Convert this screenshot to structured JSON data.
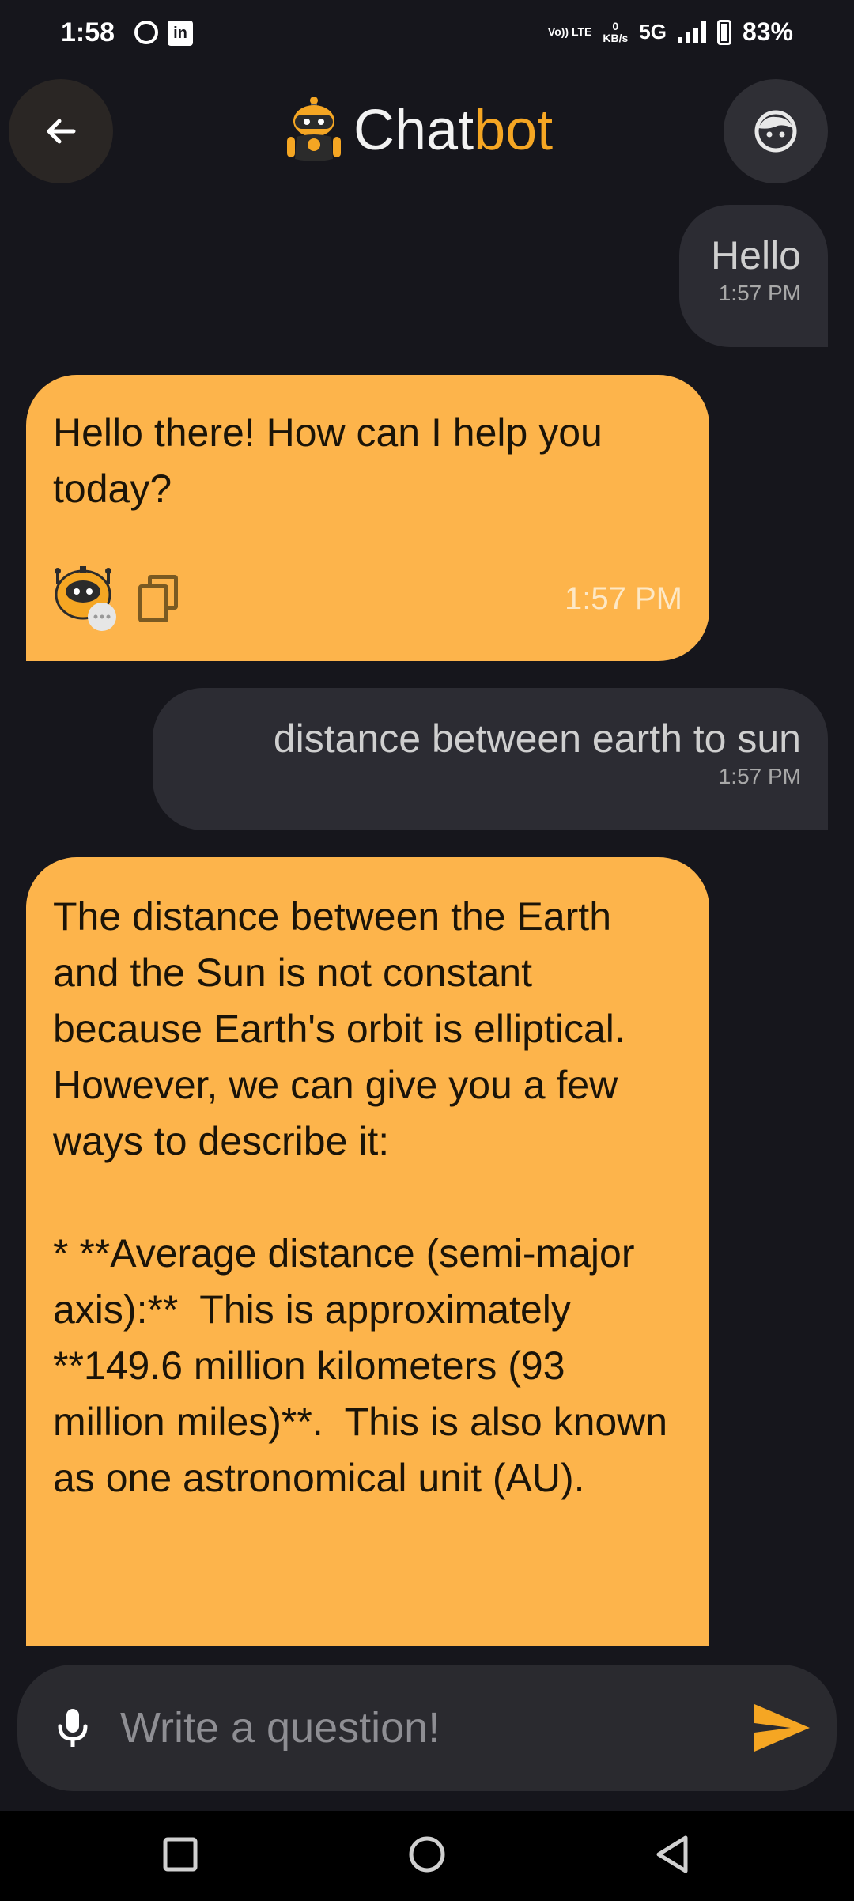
{
  "status_bar": {
    "time": "1:58",
    "volte": "Vo)) LTE",
    "data_rate_value": "0",
    "data_rate_unit": "KB/s",
    "network": "5G",
    "battery": "83%",
    "left_icons": [
      "circle-icon",
      "linkedin-icon"
    ]
  },
  "header": {
    "title_part1": "Chat",
    "title_part2": "bot",
    "brand_color": "#f5a623"
  },
  "messages": [
    {
      "role": "user",
      "text": "Hello",
      "time": "1:57 PM"
    },
    {
      "role": "bot",
      "text": "Hello there! How can I help you today?",
      "time": "1:57 PM"
    },
    {
      "role": "user",
      "text": "distance between earth to sun",
      "time": "1:57 PM"
    },
    {
      "role": "bot",
      "text": "The distance between the Earth and the Sun is not constant because Earth's orbit is elliptical.  However, we can give you a few ways to describe it:\n\n* **Average distance (semi-major axis):**  This is approximately **149.6 million kilometers (93 million miles)**.  This is also known as one astronomical unit (AU)."
    }
  ],
  "input": {
    "placeholder": "Write a question!",
    "value": ""
  },
  "colors": {
    "background": "#16161c",
    "bot_bubble": "#fdb44b",
    "user_bubble": "#2c2c33",
    "accent": "#f5a623"
  }
}
